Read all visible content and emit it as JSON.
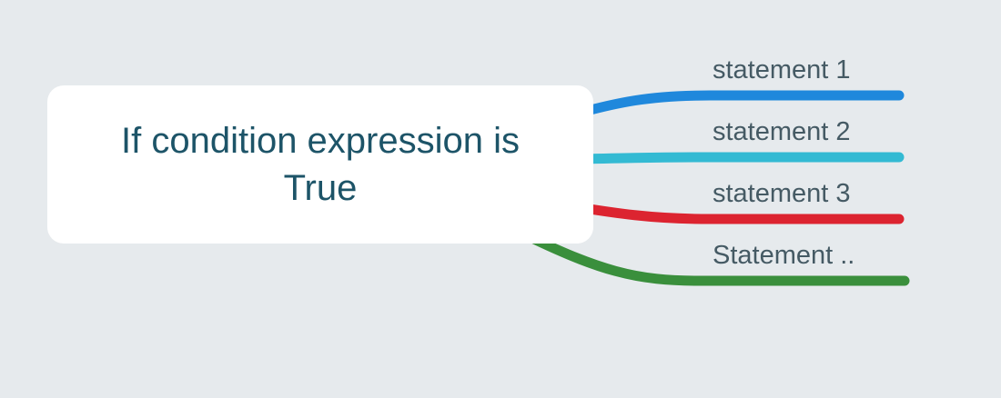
{
  "root": {
    "text": "If condition expression is True"
  },
  "branches": [
    {
      "label": "statement 1",
      "color": "#1f88dc"
    },
    {
      "label": "statement 2",
      "color": "#33bad3"
    },
    {
      "label": "statement 3",
      "color": "#dc2430"
    },
    {
      "label": "Statement ..",
      "color": "#3a8f3c"
    }
  ]
}
